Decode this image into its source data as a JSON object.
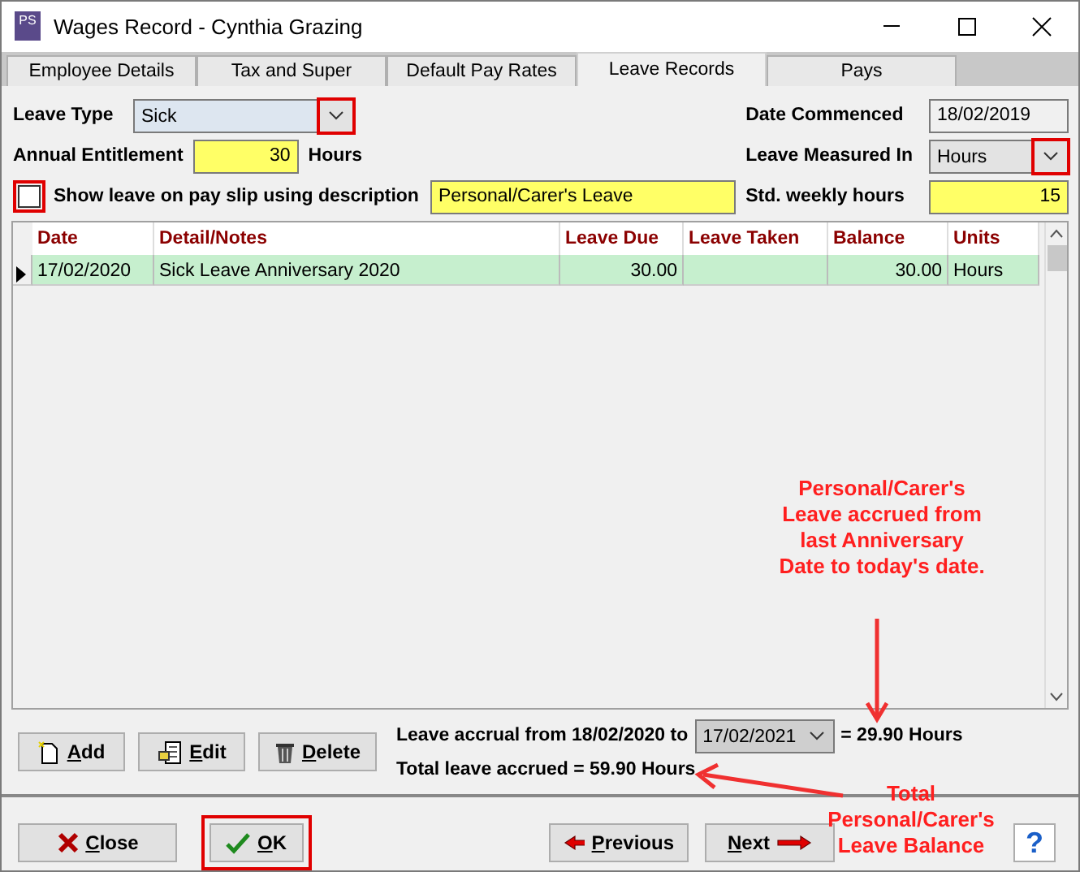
{
  "window": {
    "title": "Wages Record - Cynthia Grazing",
    "app_icon": "PS"
  },
  "tabs": [
    {
      "label": "Employee Details",
      "selected": false
    },
    {
      "label": "Tax and Super",
      "selected": false
    },
    {
      "label": "Default Pay Rates",
      "selected": false
    },
    {
      "label": "Leave Records",
      "selected": true
    },
    {
      "label": "Pays",
      "selected": false
    }
  ],
  "form": {
    "leave_type": {
      "label": "Leave Type",
      "value": "Sick",
      "highlighted": true
    },
    "annual_entitlement": {
      "label": "Annual Entitlement",
      "value": "30",
      "unit": "Hours"
    },
    "show_on_payslip": {
      "label": "Show leave on pay slip using description",
      "checked": false,
      "highlighted": true,
      "description": "Personal/Carer's Leave"
    },
    "date_commenced": {
      "label": "Date Commenced",
      "value": "18/02/2019"
    },
    "leave_measured_in": {
      "label": "Leave Measured In",
      "value": "Hours",
      "highlighted": true
    },
    "std_weekly_hours": {
      "label": "Std. weekly hours",
      "value": "15"
    }
  },
  "table": {
    "columns": [
      "Date",
      "Detail/Notes",
      "Leave Due",
      "Leave Taken",
      "Balance",
      "Units"
    ],
    "rows": [
      {
        "selected": true,
        "cells": [
          "17/02/2020",
          "Sick Leave Anniversary 2020",
          "30.00",
          "",
          "30.00",
          "Hours"
        ]
      }
    ]
  },
  "record_buttons": [
    {
      "label": "Add",
      "kind": "add"
    },
    {
      "label": "Edit",
      "kind": "edit"
    },
    {
      "label": "Delete",
      "kind": "delete"
    }
  ],
  "accrual": {
    "from_text": "Leave accrual from 18/02/2020 to",
    "to_date": "17/02/2021",
    "result": "= 29.90 Hours",
    "total": "Total leave accrued = 59.90 Hours"
  },
  "footer_buttons": [
    {
      "label": "Close",
      "kind": "close",
      "highlighted": false
    },
    {
      "label": "OK",
      "kind": "ok",
      "highlighted": true
    },
    {
      "label": "Previous",
      "kind": "previous",
      "highlighted": false
    },
    {
      "label": "Next",
      "kind": "next",
      "highlighted": false
    },
    {
      "label": "?",
      "kind": "help",
      "highlighted": false
    }
  ],
  "annotations": [
    {
      "text": "Personal/Carer's Leave accrued from last Anniversary Date to today's date."
    },
    {
      "text": "Total Personal/Carer's Leave Balance"
    }
  ]
}
